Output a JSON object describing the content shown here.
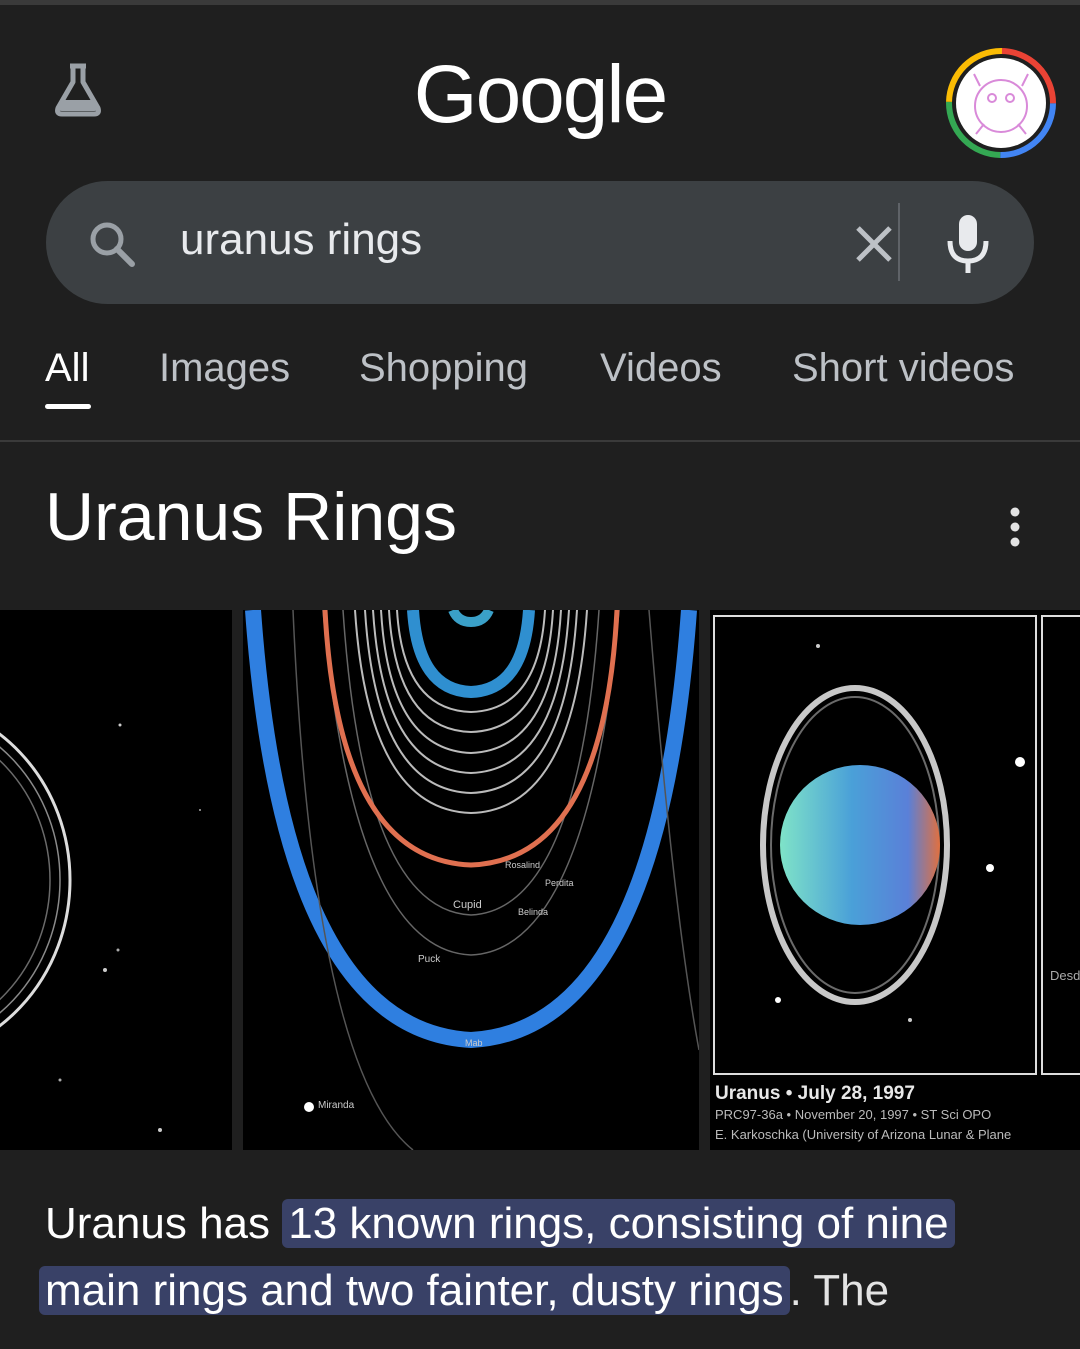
{
  "header": {
    "logo_text": "Google",
    "labs_icon": "labs-flask-icon",
    "avatar_icon": "account-avatar"
  },
  "search": {
    "query": "uranus rings",
    "search_icon": "search-icon",
    "clear_icon": "clear-icon",
    "mic_icon": "mic-icon"
  },
  "tabs": [
    {
      "label": "All",
      "active": true
    },
    {
      "label": "Images"
    },
    {
      "label": "Shopping"
    },
    {
      "label": "Videos"
    },
    {
      "label": "Short videos"
    }
  ],
  "result": {
    "title": "Uranus Rings",
    "images": [
      {
        "labels": []
      },
      {
        "labels": [
          "Cupid",
          "Belinda",
          "Rosalind",
          "Perdita",
          "Puck",
          "Mab",
          "Miranda"
        ]
      },
      {
        "caption_line1": "Uranus • July 28, 1997",
        "caption_line2": "PRC97-36a • November 20, 1997 • ST Sci OPO",
        "caption_line3": "E. Karkoschka (University of Arizona Lunar & Plane",
        "edge_text": "Desd"
      }
    ],
    "description": {
      "lead": "Uranus has ",
      "highlight_line1": "13 known rings, consisting of nine",
      "highlight_line2": "main rings and two fainter, dusty rings",
      "tail": ". The"
    }
  },
  "colors": {
    "background": "#1f1f1f",
    "search_bar": "#3c4043",
    "highlight": "#394167",
    "ring_blue": "#2f7fe0",
    "ring_orange": "#e07050"
  }
}
